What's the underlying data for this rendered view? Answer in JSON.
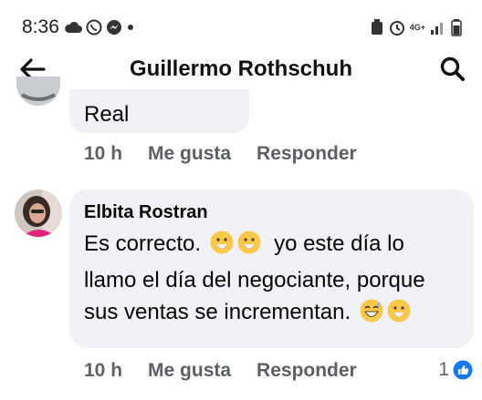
{
  "status_bar": {
    "time": "8:36",
    "network": "4G+"
  },
  "header": {
    "title": "Guillermo Rothschuh"
  },
  "comment1": {
    "text": "Real",
    "time": "10 h",
    "like_label": "Me gusta",
    "reply_label": "Responder"
  },
  "comment2": {
    "author": "Elbita Rostran",
    "text_parts": [
      "Es correcto.",
      "yo este día lo llamo el día del negociante, porque sus ventas se incrementan."
    ],
    "time": "10 h",
    "like_label": "Me gusta",
    "reply_label": "Responder",
    "reaction_count": "1"
  },
  "colors": {
    "bubble": "#f0f2f5",
    "meta_text": "#5c5f64",
    "like_blue": "#1877f2"
  }
}
